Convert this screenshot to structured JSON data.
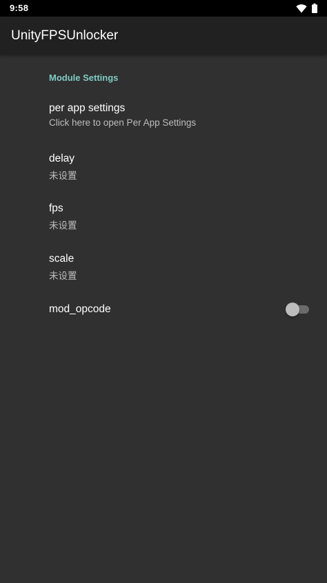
{
  "status_bar": {
    "time": "9:58",
    "icons": [
      "wifi-icon",
      "battery-icon"
    ]
  },
  "app_bar": {
    "title": "UnityFPSUnlocker"
  },
  "settings": {
    "category_title": "Module Settings",
    "items": [
      {
        "title": "per app settings",
        "summary": "Click here to open Per App Settings"
      },
      {
        "title": "delay",
        "summary": "未设置"
      },
      {
        "title": "fps",
        "summary": "未设置"
      },
      {
        "title": "scale",
        "summary": "未设置"
      },
      {
        "title": "mod_opcode",
        "switch_on": false
      }
    ]
  },
  "colors": {
    "background": "#303030",
    "app_bar": "#212121",
    "accent": "#80cbc4",
    "status_bar": "#000000"
  }
}
